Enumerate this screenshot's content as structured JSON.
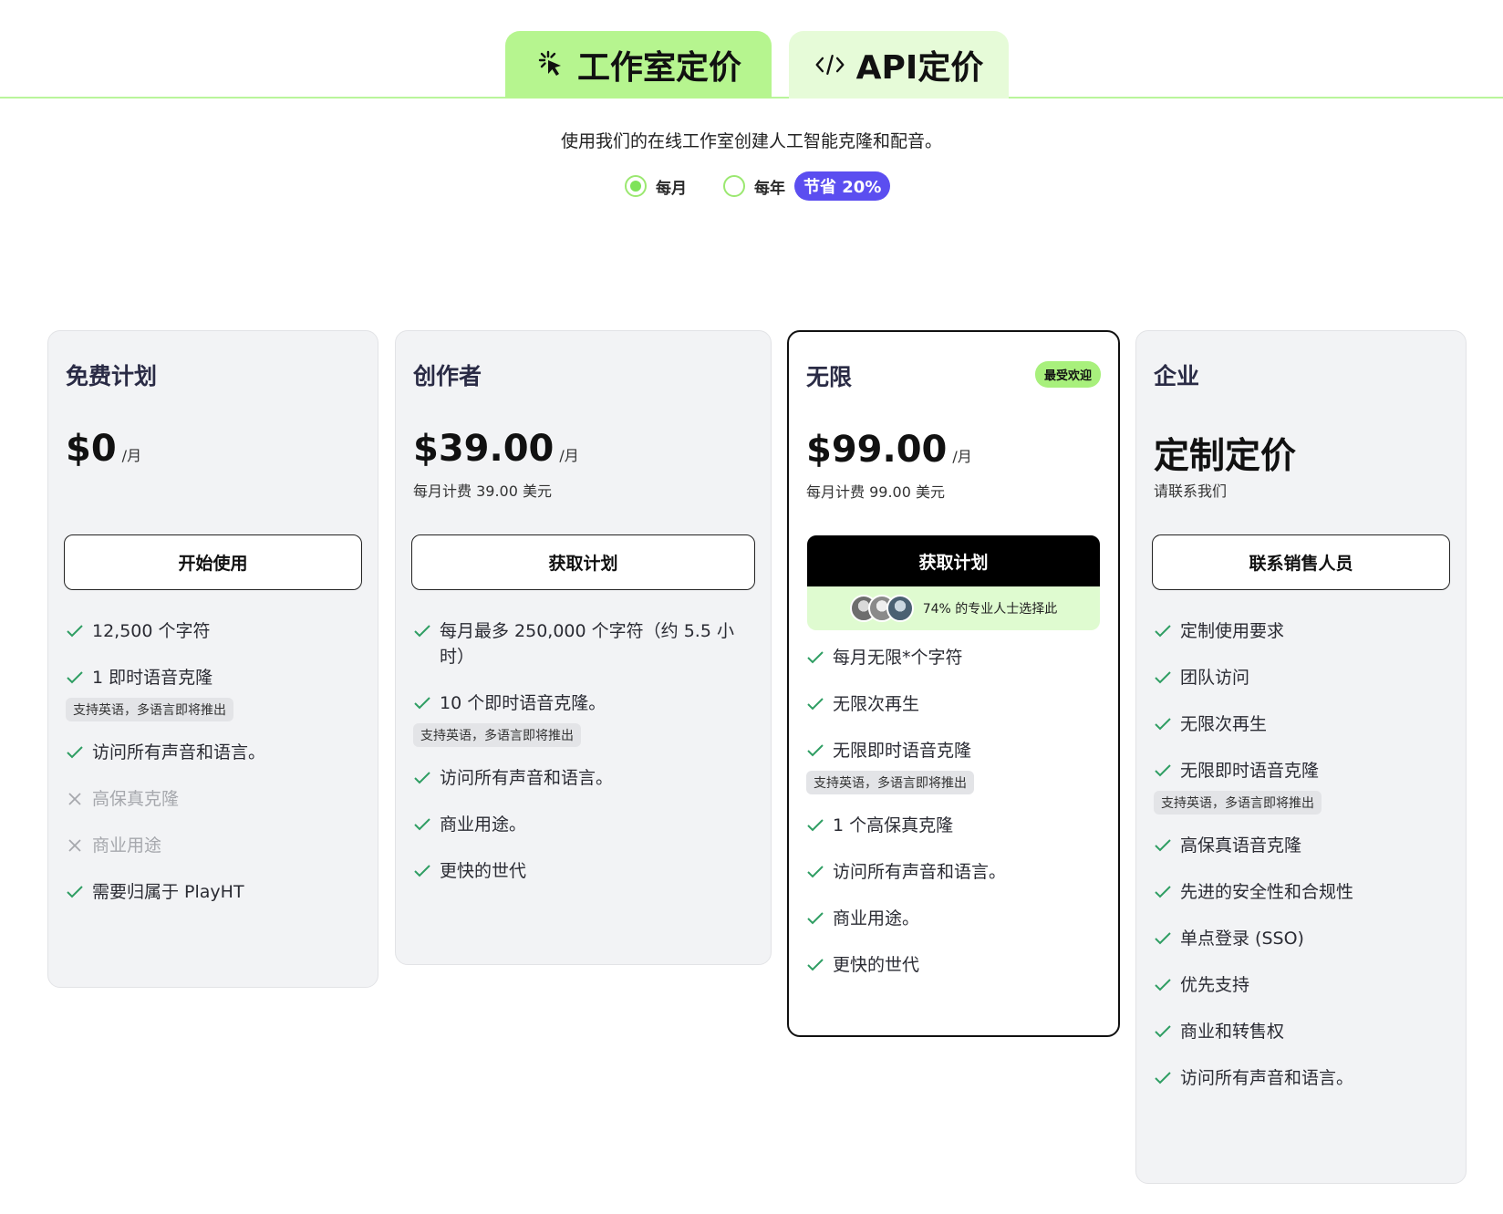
{
  "tabs": [
    {
      "label": "工作室定价",
      "icon": "click-sparkle-icon",
      "active": true
    },
    {
      "label": "API定价",
      "icon": "code-icon",
      "active": false
    }
  ],
  "subtitle": "使用我们的在线工作室创建人工智能克隆和配音。",
  "billing": {
    "monthly_label": "每月",
    "yearly_label": "每年",
    "save_badge": "节省 20%",
    "selected": "monthly"
  },
  "plans": [
    {
      "name": "免费计划",
      "price": "$0",
      "per": "/月",
      "cta": "开始使用",
      "features": [
        {
          "text": "12,500 个字符",
          "included": true
        },
        {
          "text": "1 即时语音克隆",
          "included": true,
          "note": "支持英语，多语言即将推出"
        },
        {
          "text": "访问所有声音和语言。",
          "included": true
        },
        {
          "text": "高保真克隆",
          "included": false
        },
        {
          "text": "商业用途",
          "included": false
        },
        {
          "text": "需要归属于 PlayHT",
          "included": true
        }
      ]
    },
    {
      "name": "创作者",
      "price": "$39.00",
      "per": "/月",
      "price_sub": "每月计费 39.00 美元",
      "cta": "获取计划",
      "features": [
        {
          "text": "每月最多 250,000 个字符（约 5.5 小时）",
          "included": true
        },
        {
          "text": "10 个即时语音克隆。",
          "included": true,
          "note": "支持英语，多语言即将推出"
        },
        {
          "text": "访问所有声音和语言。",
          "included": true
        },
        {
          "text": "商业用途。",
          "included": true
        },
        {
          "text": "更快的世代",
          "included": true
        }
      ]
    },
    {
      "name": "无限",
      "badge": "最受欢迎",
      "price": "$99.00",
      "per": "/月",
      "price_sub": "每月计费 99.00 美元",
      "cta": "获取计划",
      "social_proof": "74% 的专业人士选择此",
      "features": [
        {
          "text": "每月无限*个字符",
          "included": true
        },
        {
          "text": "无限次再生",
          "included": true
        },
        {
          "text": "无限即时语音克隆",
          "included": true,
          "note": "支持英语，多语言即将推出"
        },
        {
          "text": "1 个高保真克隆",
          "included": true
        },
        {
          "text": "访问所有声音和语言。",
          "included": true
        },
        {
          "text": "商业用途。",
          "included": true
        },
        {
          "text": "更快的世代",
          "included": true
        }
      ]
    },
    {
      "name": "企业",
      "price": "定制定价",
      "price_sub": "请联系我们",
      "cta": "联系销售人员",
      "features": [
        {
          "text": "定制使用要求",
          "included": true
        },
        {
          "text": "团队访问",
          "included": true
        },
        {
          "text": "无限次再生",
          "included": true
        },
        {
          "text": "无限即时语音克隆",
          "included": true,
          "note": "支持英语，多语言即将推出"
        },
        {
          "text": "高保真语音克隆",
          "included": true
        },
        {
          "text": "先进的安全性和合规性",
          "included": true
        },
        {
          "text": "单点登录 (SSO)",
          "included": true
        },
        {
          "text": "优先支持",
          "included": true
        },
        {
          "text": "商业和转售权",
          "included": true
        },
        {
          "text": "访问所有声音和语言。",
          "included": true
        }
      ]
    }
  ],
  "colors": {
    "tab_active": "#b6f58f",
    "tab_inactive": "#e6fbd8",
    "check": "#2f9e63",
    "save_badge": "#5b4ef0",
    "popular_badge": "#a8f07c"
  }
}
